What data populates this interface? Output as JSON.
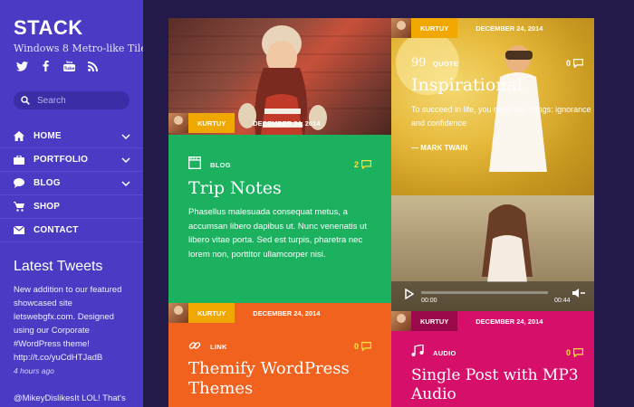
{
  "site": {
    "brand": "STACK",
    "tagline": "Windows 8 Metro-like Tiles",
    "social_icons": [
      "twitter-icon",
      "facebook-icon",
      "youtube-icon",
      "rss-icon"
    ],
    "search_placeholder": "Search"
  },
  "nav": [
    {
      "label": "HOME",
      "icon": "home-icon",
      "has_submenu": true
    },
    {
      "label": "PORTFOLIO",
      "icon": "briefcase-icon",
      "has_submenu": true
    },
    {
      "label": "BLOG",
      "icon": "chat-bubble-icon",
      "has_submenu": true
    },
    {
      "label": "SHOP",
      "icon": "cart-icon",
      "has_submenu": false
    },
    {
      "label": "CONTACT",
      "icon": "envelope-icon",
      "has_submenu": false
    }
  ],
  "tweets": {
    "title": "Latest Tweets",
    "items": [
      {
        "l1": "New addition to our featured",
        "l2": "showcased site",
        "l3": "letswebgfx.com. Designed",
        "l4": "using our Corporate",
        "l5": "#WordPress theme!",
        "l6": "http://t.co/yuCdHTJadB",
        "time": "4 hours ago"
      },
      {
        "l1": "@MikeyDislikesIt LOL! That's"
      }
    ]
  },
  "tiles": {
    "photo_top": {
      "author": "KURTUY",
      "date": "DECEMBER 24, 2014"
    },
    "trip": {
      "type": "BLOG",
      "comments": "2",
      "title": "Trip Notes",
      "body": [
        "Phasellus malesuada consequat metus, a",
        "accumsan libero dapibus ut. Nunc venenatis ut",
        "libero vitae porta. Sed est turpis, pharetra nec",
        "lorem non, porttitor ullamcorper nisi."
      ]
    },
    "quote": {
      "author": "KURTUY",
      "date": "DECEMBER 24, 2014",
      "number": "99",
      "type": "QUOTE",
      "comments": "0",
      "title": "Inspirational",
      "body": [
        "To succeed in life, you need two things: ignorance",
        "and confidence"
      ],
      "cite": "— MARK TWAIN"
    },
    "video": {
      "time_start": "00:00",
      "time_end": "00:44"
    },
    "link": {
      "author": "KURTUY",
      "date": "DECEMBER 24, 2014",
      "type": "LINK",
      "comments": "0",
      "title_l1": "Themify WordPress",
      "title_l2": "Themes"
    },
    "audio": {
      "author": "KURTUY",
      "date": "DECEMBER 24, 2014",
      "type": "AUDIO",
      "comments": "0",
      "title_l1": "Single Post with MP3",
      "title_l2": "Audio"
    }
  },
  "colors": {
    "sidebar": "#4b3bc4",
    "background": "#241a4a",
    "green": "#1bb15f",
    "orange": "#f2621f",
    "magenta": "#d60f6a",
    "author_tag": "#f0a800"
  }
}
